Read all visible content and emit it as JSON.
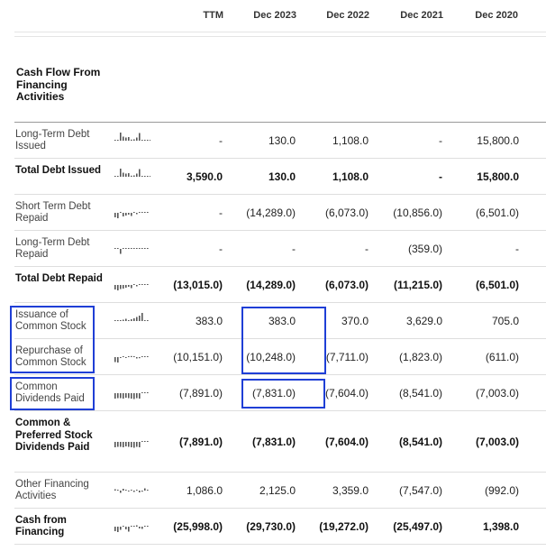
{
  "columns": [
    "TTM",
    "Dec 2023",
    "Dec 2022",
    "Dec 2021",
    "Dec 2020"
  ],
  "section_title": "Cash Flow From Financing Activities",
  "highlight_color": "#1f3fd6",
  "rows": [
    {
      "label": "Long-Term Debt Issued",
      "bold": false,
      "values": [
        "-",
        "130.0",
        "1,108.0",
        "-",
        "15,800.0"
      ],
      "spark": [
        0,
        0,
        0.9,
        0.45,
        0.35,
        0.4,
        0.12,
        0.15,
        0.35,
        0.85,
        0,
        0,
        0,
        0
      ]
    },
    {
      "label": "Total Debt Issued",
      "bold": true,
      "values": [
        "3,590.0",
        "130.0",
        "1,108.0",
        "-",
        "15,800.0"
      ],
      "spark": [
        0,
        0,
        0.9,
        0.45,
        0.35,
        0.4,
        0.12,
        0.15,
        0.35,
        0.85,
        0,
        0,
        0,
        0
      ]
    },
    {
      "label": "Short Term Debt Repaid",
      "bold": false,
      "values": [
        "-",
        "(14,289.0)",
        "(6,073.0)",
        "(10,856.0)",
        "(6,501.0)"
      ],
      "spark": [
        -0.5,
        -0.6,
        0,
        -0.4,
        -0.3,
        -0.2,
        -0.35,
        0,
        -0.15,
        0,
        0,
        0.1,
        0
      ]
    },
    {
      "label": "Long-Term Debt Repaid",
      "bold": false,
      "values": [
        "-",
        "-",
        "-",
        "(359.0)",
        "-"
      ],
      "spark": [
        0,
        0,
        -0.55,
        0,
        0,
        0,
        0,
        0,
        0,
        0,
        0,
        0,
        0
      ]
    },
    {
      "label": "Total Debt Repaid",
      "bold": true,
      "values": [
        "(13,015.0)",
        "(14,289.0)",
        "(6,073.0)",
        "(11,215.0)",
        "(6,501.0)"
      ],
      "spark": [
        -0.5,
        -0.6,
        -0.45,
        -0.4,
        -0.3,
        -0.2,
        -0.35,
        0,
        -0.15,
        0,
        0,
        0.1,
        0
      ]
    },
    {
      "label": "Issuance of Common Stock",
      "bold": false,
      "values": [
        "383.0",
        "383.0",
        "370.0",
        "3,629.0",
        "705.0"
      ],
      "spark": [
        0.05,
        0,
        0,
        0.15,
        0.25,
        0.1,
        0.2,
        0.3,
        0.45,
        0.6,
        0.9,
        0,
        0
      ]
    },
    {
      "label": "Repurchase of Common Stock",
      "bold": false,
      "values": [
        "(10,151.0)",
        "(10,248.0)",
        "(7,711.0)",
        "(1,823.0)",
        "(611.0)"
      ],
      "spark": [
        -0.55,
        -0.6,
        -0.1,
        0,
        -0.05,
        0,
        0.12,
        0,
        -0.15,
        -0.12,
        0,
        0,
        0
      ]
    },
    {
      "label": "Common Dividends Paid",
      "bold": false,
      "values": [
        "(7,891.0)",
        "(7,831.0)",
        "(7,604.0)",
        "(8,541.0)",
        "(7,003.0)"
      ],
      "spark": [
        -0.6,
        -0.55,
        -0.55,
        -0.6,
        -0.5,
        -0.55,
        -0.6,
        -0.65,
        -0.55,
        -0.6,
        0,
        0,
        0
      ]
    },
    {
      "label": "Common & Preferred Stock Dividends Paid",
      "bold": true,
      "values": [
        "(7,891.0)",
        "(7,831.0)",
        "(7,604.0)",
        "(8,541.0)",
        "(7,003.0)"
      ],
      "spark": [
        -0.6,
        -0.55,
        -0.55,
        -0.6,
        -0.5,
        -0.55,
        -0.6,
        -0.65,
        -0.55,
        -0.6,
        0,
        0,
        0
      ]
    },
    {
      "label": "Other Financing Activities",
      "bold": false,
      "values": [
        "1,086.0",
        "2,125.0",
        "3,359.0",
        "(7,547.0)",
        "(992.0)"
      ],
      "spark": [
        0.15,
        0,
        -0.25,
        0.2,
        0,
        -0.1,
        0,
        -0.15,
        0.1,
        -0.2,
        -0.12,
        0.25,
        0
      ]
    },
    {
      "label": "Cash from Financing",
      "bold": true,
      "values": [
        "(25,998.0)",
        "(29,730.0)",
        "(19,272.0)",
        "(25,497.0)",
        "1,398.0"
      ],
      "spark": [
        -0.5,
        -0.6,
        -0.35,
        0,
        -0.3,
        -0.55,
        0,
        0,
        0.15,
        -0.2,
        -0.25,
        0.1,
        0
      ]
    }
  ]
}
